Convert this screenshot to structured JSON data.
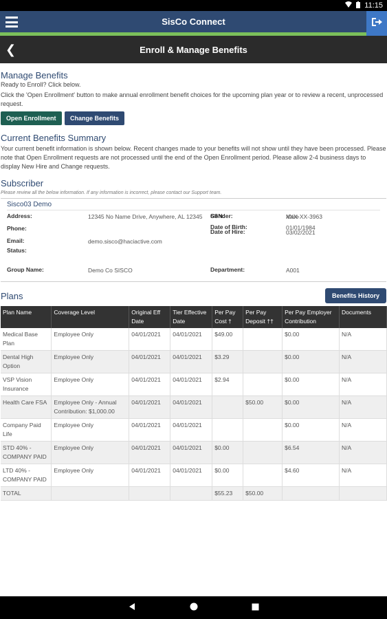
{
  "status": {
    "time": "11:15"
  },
  "app": {
    "title": "SisCo Connect"
  },
  "page": {
    "title": "Enroll & Manage Benefits"
  },
  "manage": {
    "heading": "Manage Benefits",
    "line1": "Ready to Enroll? Click below.",
    "line2": "Click the 'Open Enrollment' button to make annual enrollment benefit choices for the upcoming plan year or to review a recent, unprocessed request.",
    "open_enrollment": "Open Enrollment",
    "change_benefits": "Change Benefits"
  },
  "summary": {
    "heading": "Current Benefits Summary",
    "text": "Your current benefit information is shown below. Recent changes made to your benefits will not show until they have been processed. Please note that Open Enrollment requests are not processed until the end of the Open Enrollment period. Please allow 2-4 business days to display New Hire and Change requests."
  },
  "subscriber": {
    "heading": "Subscriber",
    "note": "Please review all the below information. If any information is incorrect, please contact our Support team.",
    "name": "Sisco03 Demo",
    "address_label": "Address:",
    "address_value": "12345 No Name Drive, Anywhere, AL 12345",
    "ssn_label": "SSN:",
    "ssn_value": "XXX-XX-3963",
    "gender_label": "Gender:",
    "gender_value": "Male",
    "phone_label": "Phone:",
    "dob_label": "Date of Birth:",
    "dob_value": "01/01/1984",
    "email_label": "Email:",
    "email_value": "demo.sisco@haciactive.com",
    "doh_label": "Date of Hire:",
    "doh_value": "03/02/2021",
    "status_label": "Status:",
    "group_label": "Group Name:",
    "group_value": "Demo Co SISCO",
    "dept_label": "Department:",
    "dept_value": "A001"
  },
  "plans": {
    "heading": "Plans",
    "history_button": "Benefits History",
    "columns": [
      "Plan Name",
      "Coverage Level",
      "Original Eff Date",
      "Tier Effective Date",
      "Per Pay Cost †",
      "Per Pay Deposit ††",
      "Per Pay Employer Contribution",
      "Documents"
    ],
    "rows": [
      [
        "Medical Base Plan",
        "Employee Only",
        "04/01/2021",
        "04/01/2021",
        "$49.00",
        "",
        "$0.00",
        "N/A"
      ],
      [
        "Dental High Option",
        "Employee Only",
        "04/01/2021",
        "04/01/2021",
        "$3.29",
        "",
        "$0.00",
        "N/A"
      ],
      [
        "VSP Vision Insurance",
        "Employee Only",
        "04/01/2021",
        "04/01/2021",
        "$2.94",
        "",
        "$0.00",
        "N/A"
      ],
      [
        "Health Care FSA",
        "Employee Only - Annual Contribution: $1,000.00",
        "04/01/2021",
        "04/01/2021",
        "",
        "$50.00",
        "$0.00",
        "N/A"
      ],
      [
        "Company Paid Life",
        "Employee Only",
        "04/01/2021",
        "04/01/2021",
        "",
        "",
        "$0.00",
        "N/A"
      ],
      [
        "STD 40% - COMPANY PAID",
        "Employee Only",
        "04/01/2021",
        "04/01/2021",
        "$0.00",
        "",
        "$6.54",
        "N/A"
      ],
      [
        "LTD 40% - COMPANY PAID",
        "Employee Only",
        "04/01/2021",
        "04/01/2021",
        "$0.00",
        "",
        "$4.60",
        "N/A"
      ],
      [
        "TOTAL",
        "",
        "",
        "",
        "$55.23",
        "$50.00",
        "",
        ""
      ]
    ]
  }
}
